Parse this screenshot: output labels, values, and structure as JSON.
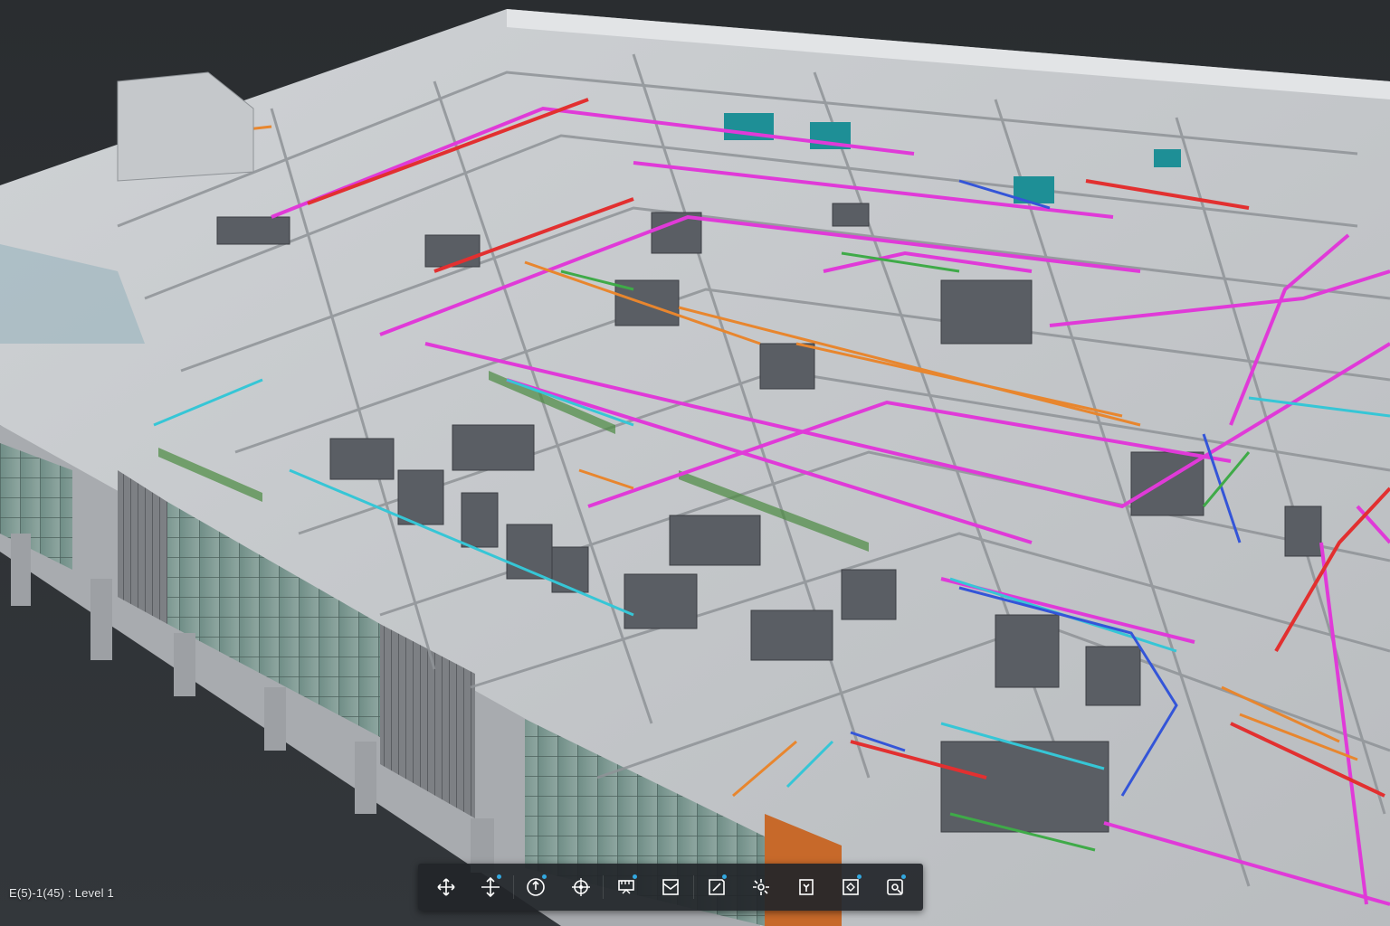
{
  "status": {
    "level_label": "E(5)-1(45) : Level 1"
  },
  "colors": {
    "background": "#2d3033",
    "toolbar_bg": "#222529",
    "accent_dot": "#33a8e0",
    "pipe_magenta": "#e03ad8",
    "pipe_red": "#e23030",
    "pipe_orange": "#e8862e",
    "pipe_cyan": "#36c6d6",
    "pipe_green": "#3faa48",
    "pipe_blue": "#3455d8",
    "cabinet_gray": "#5a5e64",
    "equipment_teal": "#1e8f96"
  },
  "toolbar": {
    "tools": [
      {
        "icon": "orbit-icon",
        "name": "orbit-tool",
        "has_menu": false
      },
      {
        "icon": "pan-icon",
        "name": "pan-tool",
        "has_menu": true
      },
      {
        "icon": "zoom-icon",
        "name": "zoom-tool",
        "has_menu": true
      },
      {
        "icon": "first-person-icon",
        "name": "first-person-tool",
        "has_menu": false
      },
      {
        "icon": "measure-icon",
        "name": "measure-tool",
        "has_menu": true
      },
      {
        "icon": "section-icon",
        "name": "section-tool",
        "has_menu": false
      },
      {
        "icon": "markup-icon",
        "name": "markup-tool",
        "has_menu": true
      },
      {
        "icon": "explode-icon",
        "name": "explode-tool",
        "has_menu": false
      },
      {
        "icon": "model-browser-icon",
        "name": "model-browser-tool",
        "has_menu": false
      },
      {
        "icon": "properties-icon",
        "name": "properties-tool",
        "has_menu": true
      },
      {
        "icon": "settings-icon",
        "name": "settings-tool",
        "has_menu": true
      }
    ]
  }
}
